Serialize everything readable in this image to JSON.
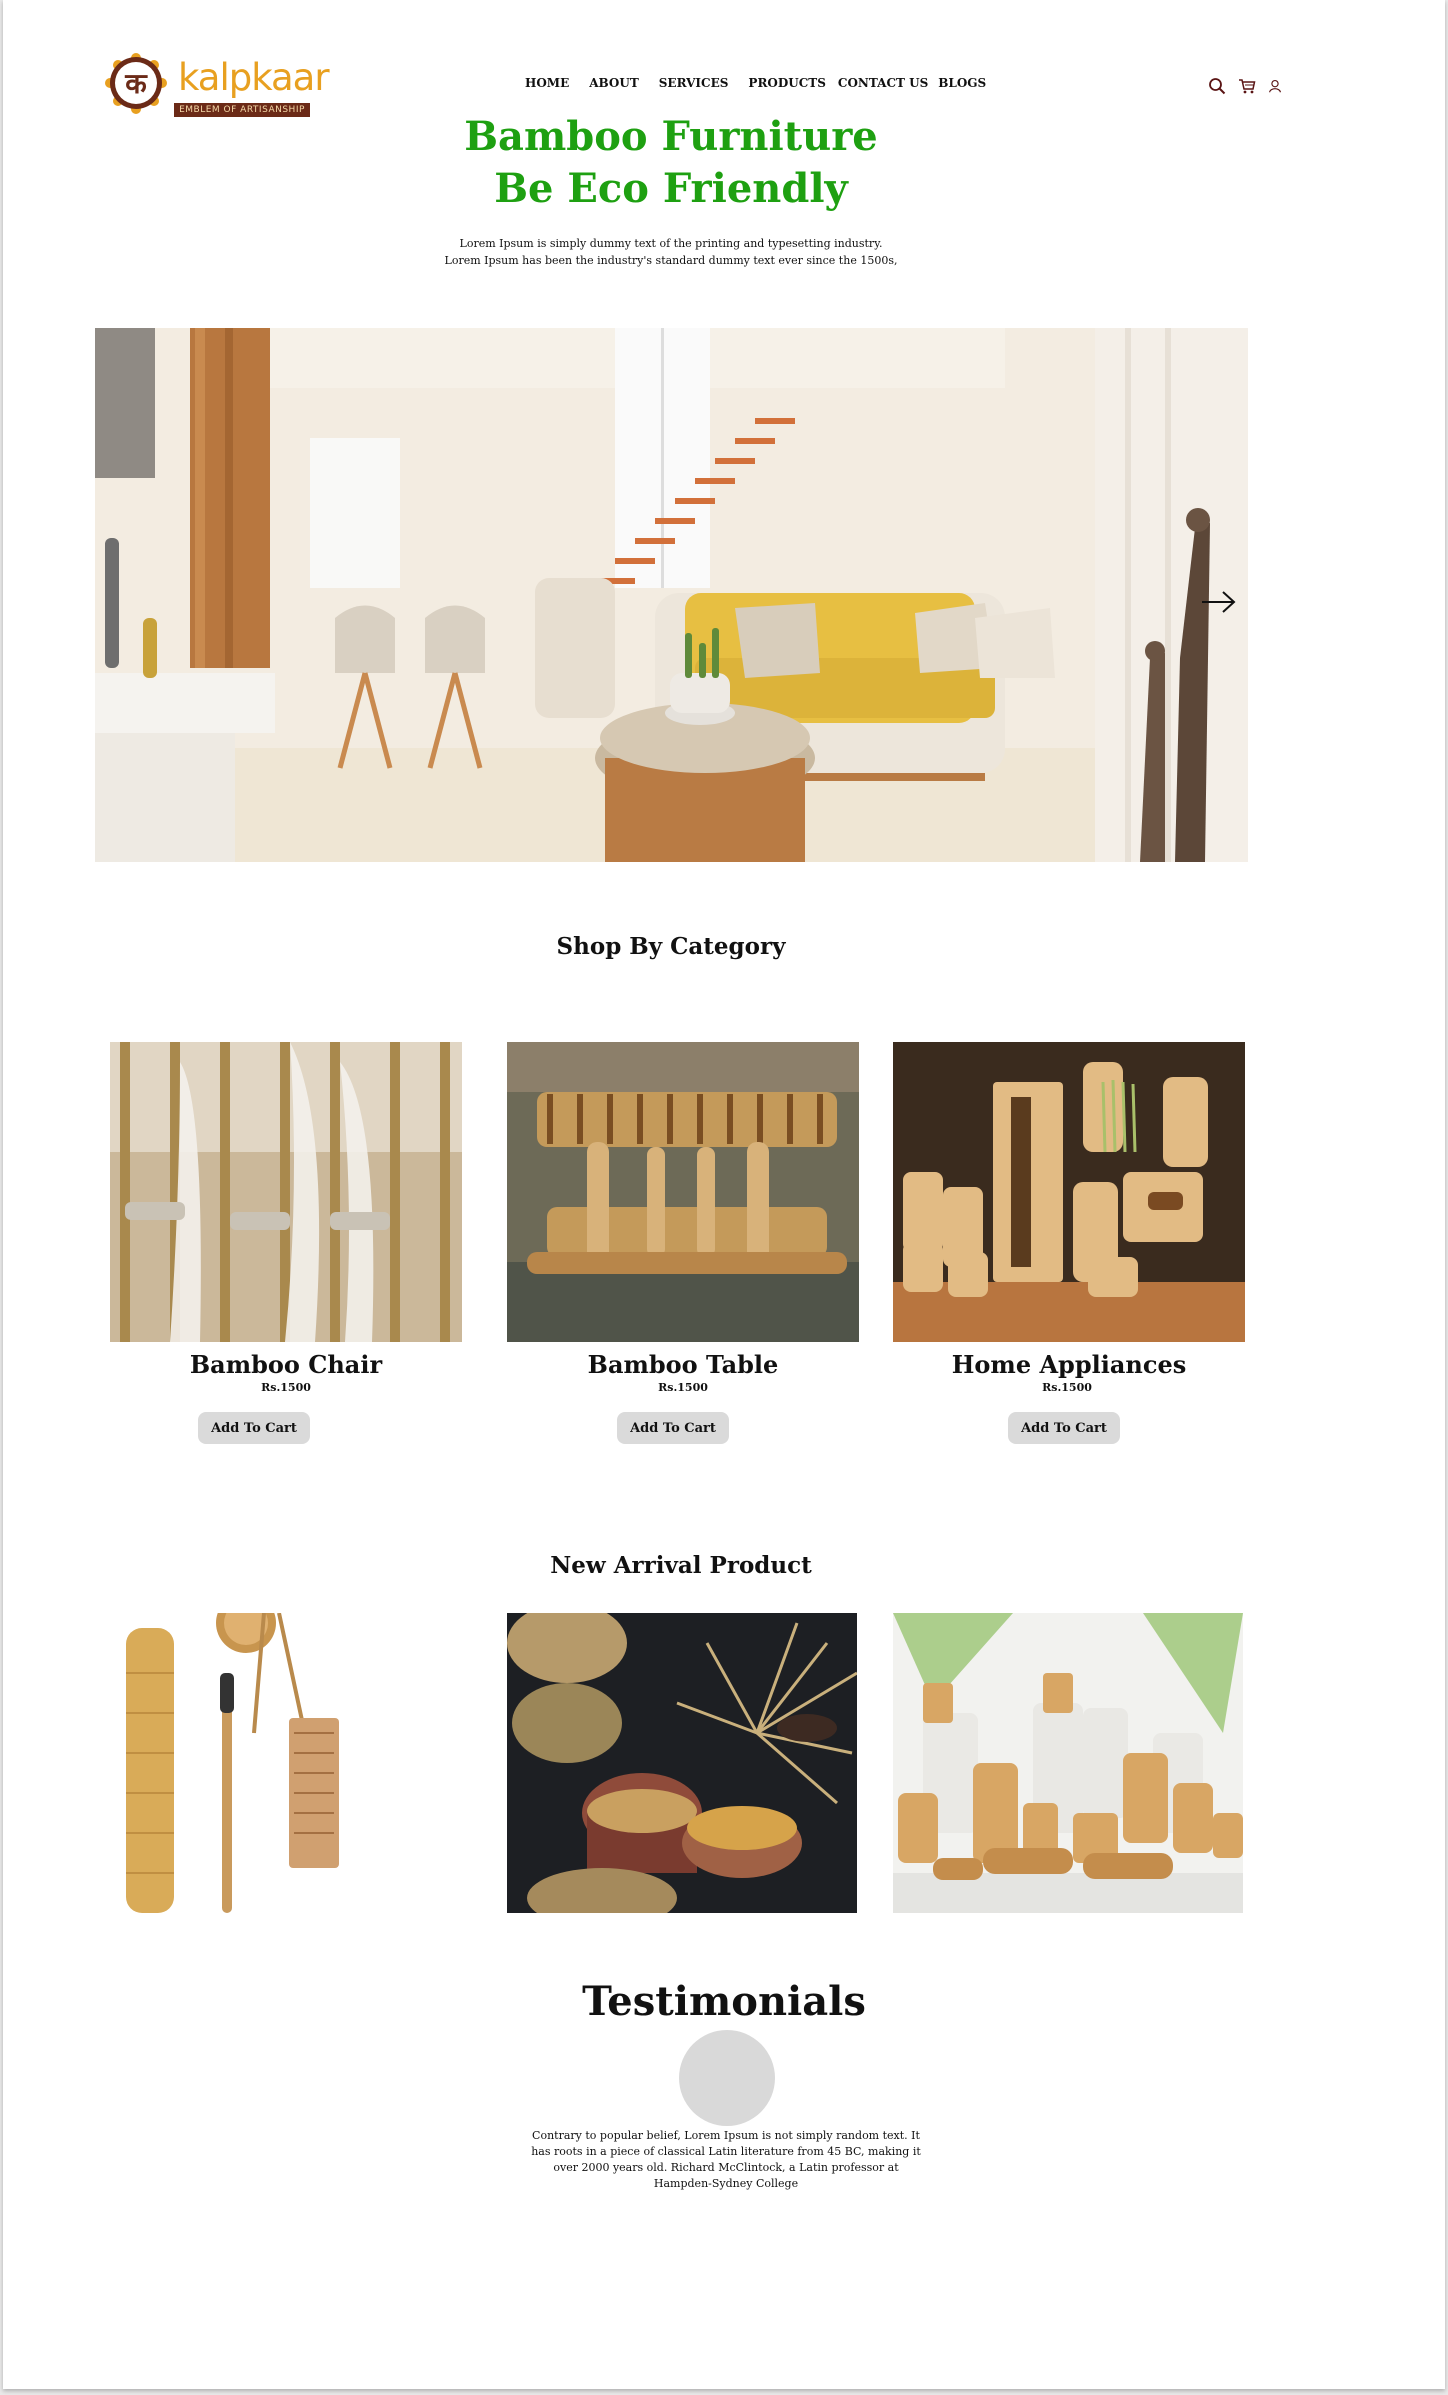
{
  "brand": {
    "name": "kalpkaar",
    "tagline": "EMBLEM OF ARTISANSHIP",
    "glyph": "क"
  },
  "nav": {
    "items": [
      {
        "label": "HOME"
      },
      {
        "label": "ABOUT"
      },
      {
        "label": "SERVICES"
      },
      {
        "label": "PRODUCTS"
      },
      {
        "label": "CONTACT US"
      },
      {
        "label": "BLOGS"
      }
    ],
    "icons": [
      "search-icon",
      "cart-icon",
      "user-icon"
    ]
  },
  "hero": {
    "title_line1": "Bamboo Furniture",
    "title_line2": "Be Eco Friendly",
    "subtitle_line1": "Lorem Ipsum is simply dummy text of the printing and typesetting industry.",
    "subtitle_line2": "Lorem Ipsum has been the industry's standard dummy text ever since the 1500s,",
    "next_icon": "arrow-right-icon"
  },
  "categories": {
    "title": "Shop By Category",
    "items": [
      {
        "name": "Bamboo Chair",
        "price": "Rs.1500",
        "button": "Add To Cart"
      },
      {
        "name": "Bamboo Table",
        "price": "Rs.1500",
        "button": "Add To Cart"
      },
      {
        "name": "Home Appliances",
        "price": "Rs.1500",
        "button": "Add To Cart"
      }
    ]
  },
  "new_arrivals": {
    "title": "New Arrival Product"
  },
  "testimonials": {
    "title": "Testimonials",
    "quote": "Contrary to popular belief, Lorem Ipsum is not simply random text. It has roots in a piece of classical Latin literature from 45 BC, making it over 2000 years old. Richard McClintock, a Latin professor at Hampden-Sydney College"
  },
  "colors": {
    "accent_green": "#1ea011",
    "logo_orange": "#e8a020",
    "logo_maroon": "#6b2a17",
    "button_gray": "#dadada"
  }
}
